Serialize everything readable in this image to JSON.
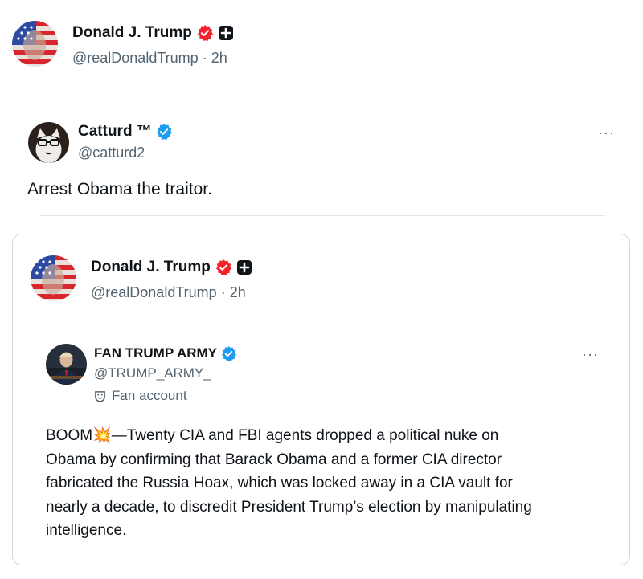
{
  "top_post": {
    "author_name": "Donald J. Trump",
    "author_handle": "@realDonaldTrump",
    "separator": "·",
    "time": "2h",
    "avatar_icon": "flag-face-avatar",
    "verified_color": "#f4212e",
    "extra_badge_icon": "plus-square-icon"
  },
  "quoted_post": {
    "author_name": "Catturd ™",
    "author_handle": "@catturd2",
    "more_label": "···",
    "verified_color": "#1d9bf0",
    "body": "Arrest Obama the traitor."
  },
  "nested_post": {
    "author_name": "Donald J. Trump",
    "author_handle": "@realDonaldTrump",
    "separator": "·",
    "time": "2h",
    "verified_color": "#f4212e",
    "inner_quote": {
      "author_name": "FAN TRUMP ARMY",
      "author_handle": "@TRUMP_ARMY_",
      "account_label": "Fan account",
      "more_label": "···",
      "verified_color": "#1d9bf0",
      "body_prefix": "BOOM",
      "body_emoji": "💥",
      "body_lines": [
        "—Twenty CIA and FBI agents dropped a political nuke on",
        "Obama by confirming that Barack Obama and a former CIA director",
        "fabricated the Russia Hoax, which was locked away in a CIA vault for",
        "nearly a decade, to discredit President Trump’s election by manipulating",
        "intelligence."
      ]
    }
  }
}
